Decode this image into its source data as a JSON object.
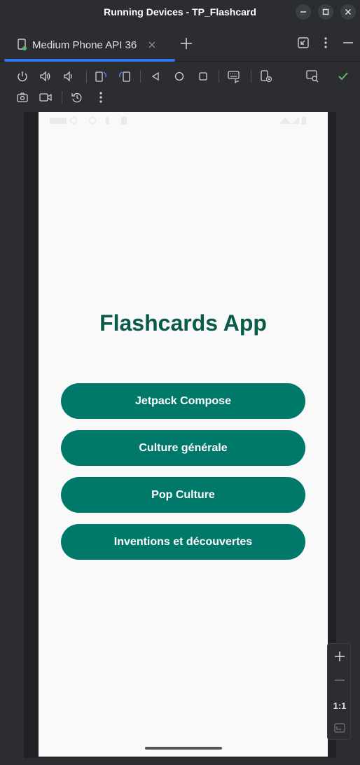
{
  "window": {
    "title": "Running Devices - TP_Flashcard"
  },
  "tabs": [
    {
      "label": "Medium Phone API 36",
      "active": true
    }
  ],
  "toolbar_icons": [
    "power-icon",
    "volume-up-icon",
    "volume-down-icon",
    "rotate-left-icon",
    "rotate-right-icon",
    "back-icon",
    "home-icon",
    "overview-icon",
    "keyboard-icon",
    "device-settings-icon",
    "screen-inspect-icon",
    "check-icon",
    "camera-icon",
    "video-icon",
    "snapshot-icon",
    "more-icon"
  ],
  "app": {
    "title": "Flashcards App",
    "buttons": [
      {
        "label": "Jetpack Compose"
      },
      {
        "label": "Culture générale"
      },
      {
        "label": "Pop Culture"
      },
      {
        "label": "Inventions et découvertes"
      }
    ]
  },
  "zoom": {
    "ratio_label": "1:1"
  },
  "colors": {
    "accent": "#3574f0",
    "app_primary": "#00796b",
    "app_title": "#0a5a4a",
    "check": "#5fb865"
  }
}
